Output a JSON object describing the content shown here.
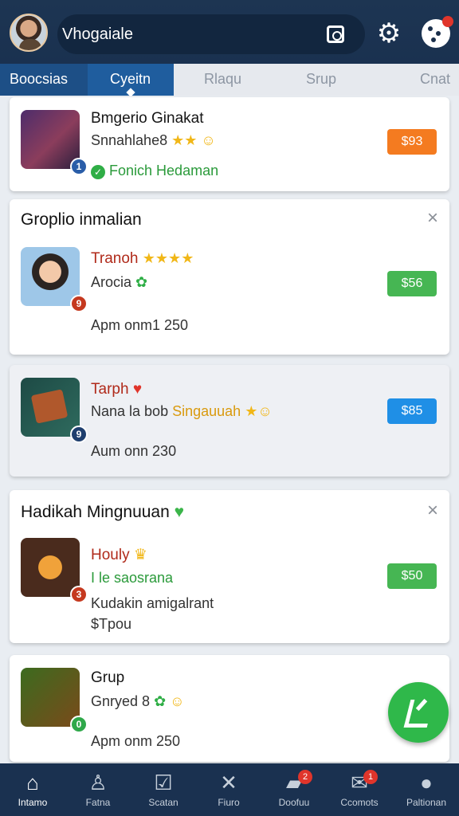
{
  "header": {
    "search_text": "Vhogaiale"
  },
  "tabs": [
    "Boocsias",
    "Cyeitn",
    "Rlaqu",
    "Srup",
    "Cnat"
  ],
  "cards": [
    {
      "title": "",
      "name": "Bmgerio Ginakat",
      "sub": "Snnahlahe8",
      "sub_stars": "★★",
      "meta": "Fonich Hedaman",
      "price": "$93",
      "price_color": "#f47b20",
      "badge": "1",
      "badge_color": "#2a5da8"
    },
    {
      "title": "Groplio inmalian",
      "name": "Tranoh",
      "name_stars": "★★★★",
      "sub": "Arocia",
      "meta": "Apm onm1 250",
      "price": "$56",
      "price_color": "#46b653",
      "badge": "9",
      "badge_color": "#c5391f"
    },
    {
      "title": "",
      "name": "Tarph",
      "sub": "Nana la bob",
      "sub_highlight": "Singauuah",
      "meta": "Aum onn 230",
      "price": "$85",
      "price_color": "#1f8fe6",
      "badge": "9",
      "badge_color": "#1f3f6e"
    },
    {
      "title": "Hadikah Mingnuuan",
      "name": "Houly",
      "sub": "I le saosrana",
      "meta": "Kudakin amigalrant",
      "meta2": "$Tpou",
      "price": "$50",
      "price_color": "#46b653",
      "badge": "3",
      "badge_color": "#c5391f"
    },
    {
      "title": "",
      "name": "Grup",
      "sub": "Gnryed 8",
      "meta": "Apm onm 250",
      "badge": "0",
      "badge_color": "#2fa84a"
    }
  ],
  "bottom_nav": [
    {
      "label": "Intamo",
      "icon": "home-icon"
    },
    {
      "label": "Fatna",
      "icon": "person-add-icon"
    },
    {
      "label": "Scatan",
      "icon": "check-box-icon"
    },
    {
      "label": "Fiuro",
      "icon": "close-icon"
    },
    {
      "label": "Doofuu",
      "icon": "folder-icon",
      "badge": "2"
    },
    {
      "label": "Ccomots",
      "icon": "mail-icon",
      "badge": "1"
    },
    {
      "label": "Paltionan",
      "icon": "profile-icon"
    }
  ]
}
